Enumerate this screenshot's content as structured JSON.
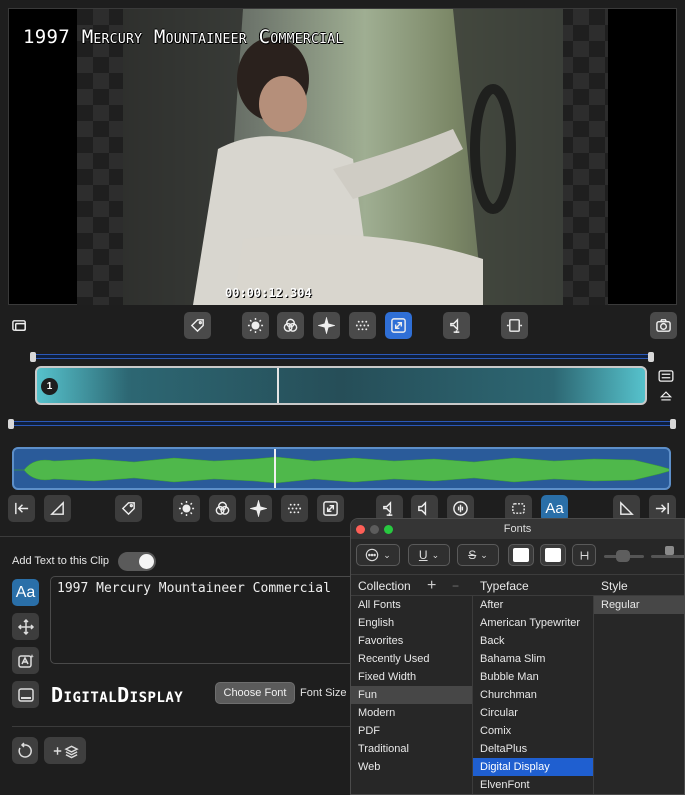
{
  "preview": {
    "overlay_title": "1997 Mercury Mountaineer Commercial",
    "timecode": "00:00:12.304"
  },
  "top_toolbar": [
    "tag-icon",
    "brightness-icon",
    "color-icon",
    "sparkle-icon",
    "noise-icon",
    "fit-icon",
    "audio-split-icon",
    "film-trim-icon"
  ],
  "clip": {
    "number": "1"
  },
  "bottom_toolbar": [
    "trim-start-icon",
    "fade-in-icon",
    "tag-icon",
    "brightness-icon",
    "color-icon",
    "sparkle-icon",
    "noise-icon",
    "fit-icon",
    "audio-split-icon",
    "volume-icon",
    "waveform-icon",
    "crop-icon",
    "text-icon",
    "fade-out-icon",
    "trim-end-icon"
  ],
  "text_panel": {
    "add_text_label": "Add Text to this Clip",
    "toggle_on": true,
    "text_icon_label": "Aa",
    "text_value": "1997 Mercury Mountaineer Commercial",
    "font_preview": "DigitalDisplay",
    "choose_font_label": "Choose Font",
    "font_size_label": "Font Size"
  },
  "fonts_panel": {
    "title": "Fonts",
    "collection_header": "Collection",
    "typeface_header": "Typeface",
    "style_header": "Style",
    "add_label": "+",
    "remove_label": "−",
    "collections": [
      "All Fonts",
      "English",
      "Favorites",
      "Recently Used",
      "Fixed Width",
      "Fun",
      "Modern",
      "PDF",
      "Traditional",
      "Web"
    ],
    "selected_collection": "Fun",
    "typefaces": [
      "After",
      "American Typewriter",
      "Back",
      "Bahama Slim",
      "Bubble Man",
      "Churchman",
      "Circular",
      "Comix",
      "DeltaPlus",
      "Digital Display",
      "ElvenFont"
    ],
    "selected_typeface": "Digital Display",
    "styles": [
      "Regular"
    ],
    "selected_style": "Regular",
    "colors": {
      "close": "#fe5f57",
      "minimize": "#5c5c5c",
      "zoom": "#28c840",
      "accent": "#1f5fd0"
    }
  }
}
